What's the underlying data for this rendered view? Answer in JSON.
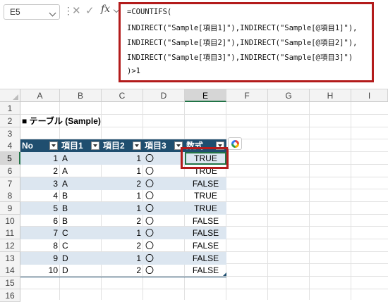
{
  "formula_bar": {
    "name_box": "E5",
    "fx_label": "fx",
    "lines": [
      "=COUNTIFS(",
      "INDIRECT(\"Sample[項目1]\"),INDIRECT(\"Sample[@項目1]\"),",
      "INDIRECT(\"Sample[項目2]\"),INDIRECT(\"Sample[@項目2]\"),",
      "INDIRECT(\"Sample[項目3]\"),INDIRECT(\"Sample[@項目3]\")",
      ")>1"
    ]
  },
  "columns": [
    "A",
    "B",
    "C",
    "D",
    "E",
    "F",
    "G",
    "H",
    "I"
  ],
  "rows": [
    "1",
    "2",
    "3",
    "4",
    "5",
    "6",
    "7",
    "8",
    "9",
    "10",
    "11",
    "12",
    "13",
    "14",
    "15",
    "16"
  ],
  "selected_column": "E",
  "selected_row": "5",
  "sheet_title": "■ テーブル (Sample)",
  "table": {
    "headers": [
      "No",
      "項目1",
      "項目2",
      "項目3",
      "数式"
    ],
    "rows": [
      {
        "no": "1",
        "item1": "A",
        "item2": "1",
        "item3": "〇",
        "formula": "TRUE"
      },
      {
        "no": "2",
        "item1": "A",
        "item2": "1",
        "item3": "〇",
        "formula": "TRUE"
      },
      {
        "no": "3",
        "item1": "A",
        "item2": "2",
        "item3": "〇",
        "formula": "FALSE"
      },
      {
        "no": "4",
        "item1": "B",
        "item2": "1",
        "item3": "〇",
        "formula": "TRUE"
      },
      {
        "no": "5",
        "item1": "B",
        "item2": "1",
        "item3": "〇",
        "formula": "TRUE"
      },
      {
        "no": "6",
        "item1": "B",
        "item2": "2",
        "item3": "〇",
        "formula": "FALSE"
      },
      {
        "no": "7",
        "item1": "C",
        "item2": "1",
        "item3": "〇",
        "formula": "FALSE"
      },
      {
        "no": "8",
        "item1": "C",
        "item2": "2",
        "item3": "〇",
        "formula": "FALSE"
      },
      {
        "no": "9",
        "item1": "D",
        "item2": "1",
        "item3": "〇",
        "formula": "FALSE"
      },
      {
        "no": "10",
        "item1": "D",
        "item2": "2",
        "item3": "〇",
        "formula": "FALSE"
      }
    ],
    "header_color": "#1f4e6f",
    "band_color": "#dce6f0"
  },
  "highlight_color": "#b31b1b",
  "selection_color": "#217346"
}
